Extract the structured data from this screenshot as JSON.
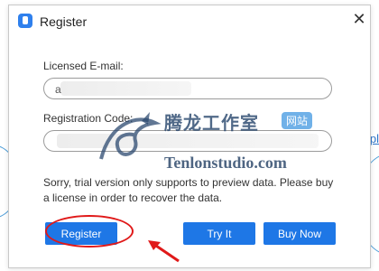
{
  "dialog": {
    "title": "Register",
    "close_symbol": "✕"
  },
  "form": {
    "email_label": "Licensed E-mail:",
    "email_value": "a",
    "code_label": "Registration Code:",
    "code_value": ""
  },
  "message": "Sorry, trial version only supports to preview data. Please buy a license in order to recover the data.",
  "buttons": {
    "register": "Register",
    "try_it": "Try It",
    "buy_now": "Buy Now"
  },
  "background": {
    "link_fragment": "pl"
  },
  "watermark": {
    "cn_text": "腾龙工作室",
    "badge": "网站",
    "url": "Tenlonstudio.com"
  },
  "colors": {
    "accent": "#1e77e6",
    "annotation": "#e01919"
  },
  "icons": {
    "app": "app-icon",
    "close": "close-icon",
    "annotation_arrow": "arrow-icon"
  }
}
